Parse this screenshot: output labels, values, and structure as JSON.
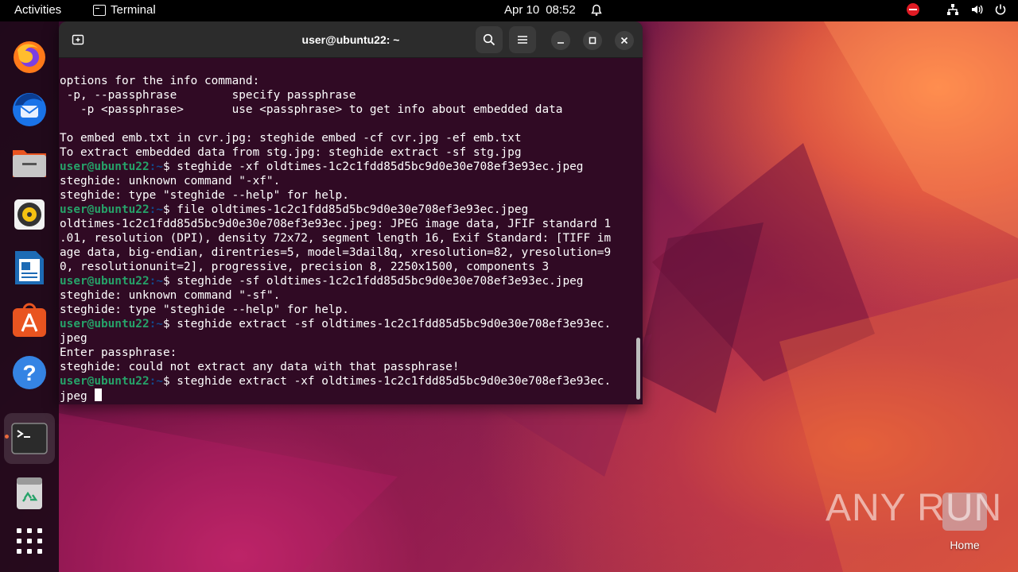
{
  "topbar": {
    "activities": "Activities",
    "app_name": "Terminal",
    "date": "Apr 10",
    "time": "08:52"
  },
  "dock": {
    "apps": [
      "firefox-icon",
      "thunderbird-icon",
      "files-icon",
      "rhythmbox-icon",
      "libreoffice-writer-icon",
      "app-center-icon",
      "help-icon",
      "terminal-icon",
      "trash-icon",
      "show-apps-icon"
    ],
    "active": "terminal-icon",
    "accent_color": "#e95420"
  },
  "terminal": {
    "title": "user@ubuntu22: ~",
    "prompt_user": "user@ubuntu22",
    "prompt_path": ":~",
    "lines": [
      {
        "kind": "out",
        "text": "options for the info command:"
      },
      {
        "kind": "out",
        "text": " -p, --passphrase        specify passphrase"
      },
      {
        "kind": "out",
        "text": "   -p <passphrase>       use <passphrase> to get info about embedded data"
      },
      {
        "kind": "out",
        "text": ""
      },
      {
        "kind": "out",
        "text": "To embed emb.txt in cvr.jpg: steghide embed -cf cvr.jpg -ef emb.txt"
      },
      {
        "kind": "out",
        "text": "To extract embedded data from stg.jpg: steghide extract -sf stg.jpg"
      },
      {
        "kind": "cmd",
        "text": "$ steghide -xf oldtimes-1c2c1fdd85d5bc9d0e30e708ef3e93ec.jpeg"
      },
      {
        "kind": "out",
        "text": "steghide: unknown command \"-xf\"."
      },
      {
        "kind": "out",
        "text": "steghide: type \"steghide --help\" for help."
      },
      {
        "kind": "cmd",
        "text": "$ file oldtimes-1c2c1fdd85d5bc9d0e30e708ef3e93ec.jpeg"
      },
      {
        "kind": "out",
        "text": "oldtimes-1c2c1fdd85d5bc9d0e30e708ef3e93ec.jpeg: JPEG image data, JFIF standard 1"
      },
      {
        "kind": "out",
        "text": ".01, resolution (DPI), density 72x72, segment length 16, Exif Standard: [TIFF im"
      },
      {
        "kind": "out",
        "text": "age data, big-endian, direntries=5, model=3dail8q, xresolution=82, yresolution=9"
      },
      {
        "kind": "out",
        "text": "0, resolutionunit=2], progressive, precision 8, 2250x1500, components 3"
      },
      {
        "kind": "cmd",
        "text": "$ steghide -sf oldtimes-1c2c1fdd85d5bc9d0e30e708ef3e93ec.jpeg"
      },
      {
        "kind": "out",
        "text": "steghide: unknown command \"-sf\"."
      },
      {
        "kind": "out",
        "text": "steghide: type \"steghide --help\" for help."
      },
      {
        "kind": "cmd",
        "text": "$ steghide extract -sf oldtimes-1c2c1fdd85d5bc9d0e30e708ef3e93ec."
      },
      {
        "kind": "out",
        "text": "jpeg"
      },
      {
        "kind": "out",
        "text": "Enter passphrase:"
      },
      {
        "kind": "out",
        "text": "steghide: could not extract any data with that passphrase!"
      },
      {
        "kind": "cmd",
        "text": "$ steghide extract -xf oldtimes-1c2c1fdd85d5bc9d0e30e708ef3e93ec."
      },
      {
        "kind": "input",
        "text": "jpeg "
      }
    ]
  },
  "desktop": {
    "watermark": "ANY RUN",
    "home_label": "Home"
  }
}
